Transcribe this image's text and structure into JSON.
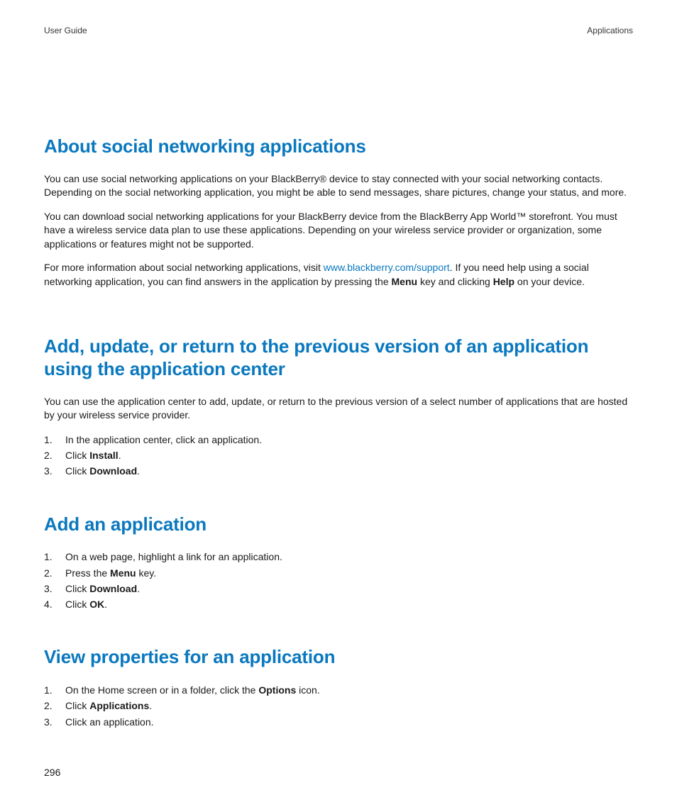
{
  "header": {
    "left": "User Guide",
    "right": "Applications"
  },
  "section1": {
    "heading": "About social networking applications",
    "p1": "You can use social networking applications on your BlackBerry® device to stay connected with your social networking contacts. Depending on the social networking application, you might be able to send messages, share pictures, change your status, and more.",
    "p2": "You can download social networking applications for your BlackBerry device from the BlackBerry App World™ storefront. You must have a wireless service data plan to use these applications. Depending on your wireless service provider or organization, some applications or features might not be supported.",
    "p3a": "For more information about social networking applications, visit ",
    "p3_link": "www.blackberry.com/support",
    "p3b": ". If you need help using a social networking application, you can find answers in the application by pressing the ",
    "p3_bold1": "Menu",
    "p3c": " key and clicking ",
    "p3_bold2": "Help",
    "p3d": " on your device."
  },
  "section2": {
    "heading": "Add, update, or return to the previous version of an application using the application center",
    "p1": "You can use the application center to add, update, or return to the previous version of a select number of applications that are hosted by your wireless service provider.",
    "steps": {
      "s1": "In the application center, click an application.",
      "s2a": "Click ",
      "s2_bold": "Install",
      "s2b": ".",
      "s3a": "Click ",
      "s3_bold": "Download",
      "s3b": "."
    }
  },
  "section3": {
    "heading": "Add an application",
    "steps": {
      "s1": "On a web page, highlight a link for an application.",
      "s2a": "Press the ",
      "s2_bold": "Menu",
      "s2b": " key.",
      "s3a": "Click ",
      "s3_bold": "Download",
      "s3b": ".",
      "s4a": "Click ",
      "s4_bold": "OK",
      "s4b": "."
    }
  },
  "section4": {
    "heading": "View properties for an application",
    "steps": {
      "s1a": "On the Home screen or in a folder, click the ",
      "s1_bold": "Options",
      "s1b": " icon.",
      "s2a": "Click ",
      "s2_bold": "Applications",
      "s2b": ".",
      "s3": "Click an application."
    }
  },
  "pageNumber": "296"
}
